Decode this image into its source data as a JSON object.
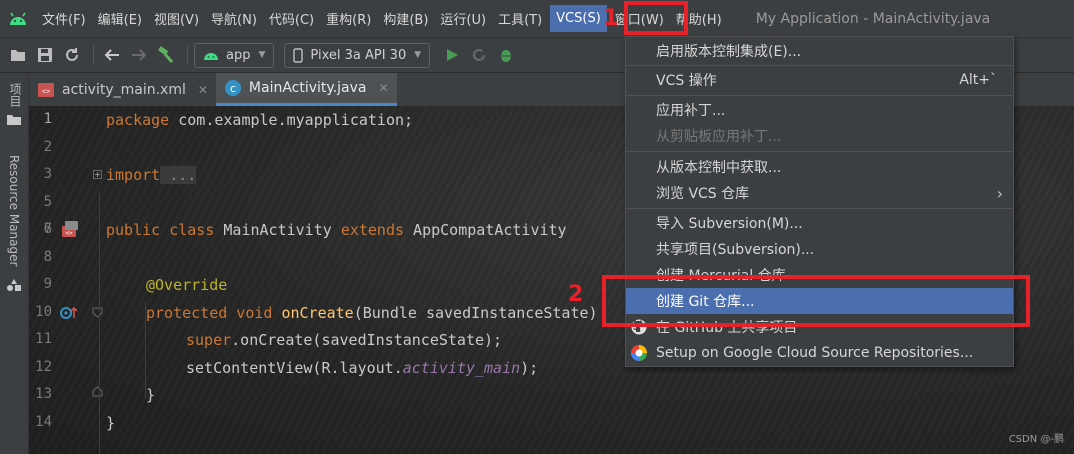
{
  "menubar": {
    "items": [
      "文件(F)",
      "编辑(E)",
      "视图(V)",
      "导航(N)",
      "代码(C)",
      "重构(R)",
      "构建(B)",
      "运行(U)",
      "工具(T)",
      "VCS(S)",
      "窗口(W)",
      "帮助(H)"
    ],
    "active_index": 9,
    "window_title": "My Application - MainActivity.java"
  },
  "toolbar": {
    "module_combo": "app",
    "device_combo": "Pixel 3a API 30"
  },
  "left_strip": {
    "project_label": "项目",
    "resource_manager_label": "Resource Manager"
  },
  "tabs": [
    {
      "label": "activity_main.xml",
      "icon": "xml-layout-icon"
    },
    {
      "label": "MainActivity.java",
      "icon": "java-class-icon"
    }
  ],
  "editor": {
    "line_numbers": [
      "1",
      "2",
      "3",
      "5",
      "6",
      "7",
      "8",
      "9",
      "10",
      "11",
      "12",
      "13",
      "14"
    ],
    "current_line_index": 0,
    "lines": {
      "l1": {
        "kw": "package",
        "rest": " com.example.myapplication;"
      },
      "l3": {
        "kw": "import",
        "rest": " ..."
      },
      "l7": {
        "kw1": "public class",
        "name": " MainActivity ",
        "kw2": "extends",
        "rest": " AppCompatActivity"
      },
      "l9": {
        "ann": "@Override"
      },
      "l10": {
        "kw": "protected void",
        "fn": " onCreate",
        "rest": "(Bundle savedInstanceState)"
      },
      "l11": {
        "kw": "super",
        "rest": ".onCreate(savedInstanceState);"
      },
      "l12": {
        "pre": "setContentView(R.layout.",
        "fld": "activity_main",
        "post": ");"
      },
      "l13": {
        "text": "}"
      },
      "l14": {
        "text": "}"
      }
    }
  },
  "vcs_menu": {
    "items": [
      {
        "label": "启用版本控制集成(E)...",
        "state": "normal"
      },
      {
        "label": "VCS 操作",
        "shortcut": "Alt+`",
        "state": "normal"
      },
      {
        "label": "应用补丁...",
        "state": "normal"
      },
      {
        "label": "从剪贴板应用补丁...",
        "state": "disabled"
      },
      {
        "label": "从版本控制中获取...",
        "state": "normal"
      },
      {
        "label": "浏览 VCS 仓库",
        "submenu": "›",
        "state": "normal"
      },
      {
        "label": "导入 Subversion(M)...",
        "state": "normal"
      },
      {
        "label": "共享项目(Subversion)...",
        "state": "normal"
      },
      {
        "label": "创建 Mercurial 仓库",
        "state": "normal"
      },
      {
        "label": "创建 Git 仓库...",
        "state": "selected"
      },
      {
        "label": "在 GitHub 上共享项目",
        "state": "normal",
        "icon": "github-icon"
      },
      {
        "label": "Setup on Google Cloud Source Repositories...",
        "state": "normal",
        "icon": "google-cloud-icon"
      }
    ]
  },
  "annotations": {
    "step1": "1",
    "step2": "2",
    "color": "#e8202a"
  },
  "watermark": "CSDN @-鹏"
}
